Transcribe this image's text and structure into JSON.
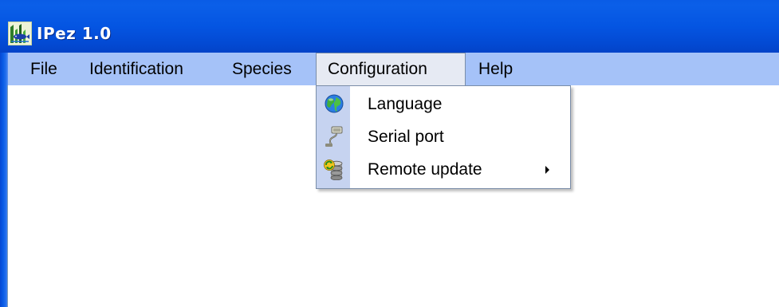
{
  "window": {
    "title": "IPez 1.0",
    "icon": "app-fish-icon"
  },
  "menubar": {
    "items": [
      {
        "label": "File"
      },
      {
        "label": "Identification"
      },
      {
        "label": "Species"
      },
      {
        "label": "Configuration"
      },
      {
        "label": "Help"
      }
    ],
    "open_menu": "Configuration"
  },
  "configuration_menu": {
    "items": [
      {
        "label": "Language",
        "icon": "globe-icon",
        "submenu": false
      },
      {
        "label": "Serial port",
        "icon": "serial-cable-icon",
        "submenu": false
      },
      {
        "label": "Remote update",
        "icon": "database-update-icon",
        "submenu": true
      }
    ]
  },
  "colors": {
    "titlebar": "#0455e2",
    "menubar": "#a5c2f8",
    "menu_gutter": "#c6d3f0",
    "active_menu": "#e6eaf3"
  }
}
